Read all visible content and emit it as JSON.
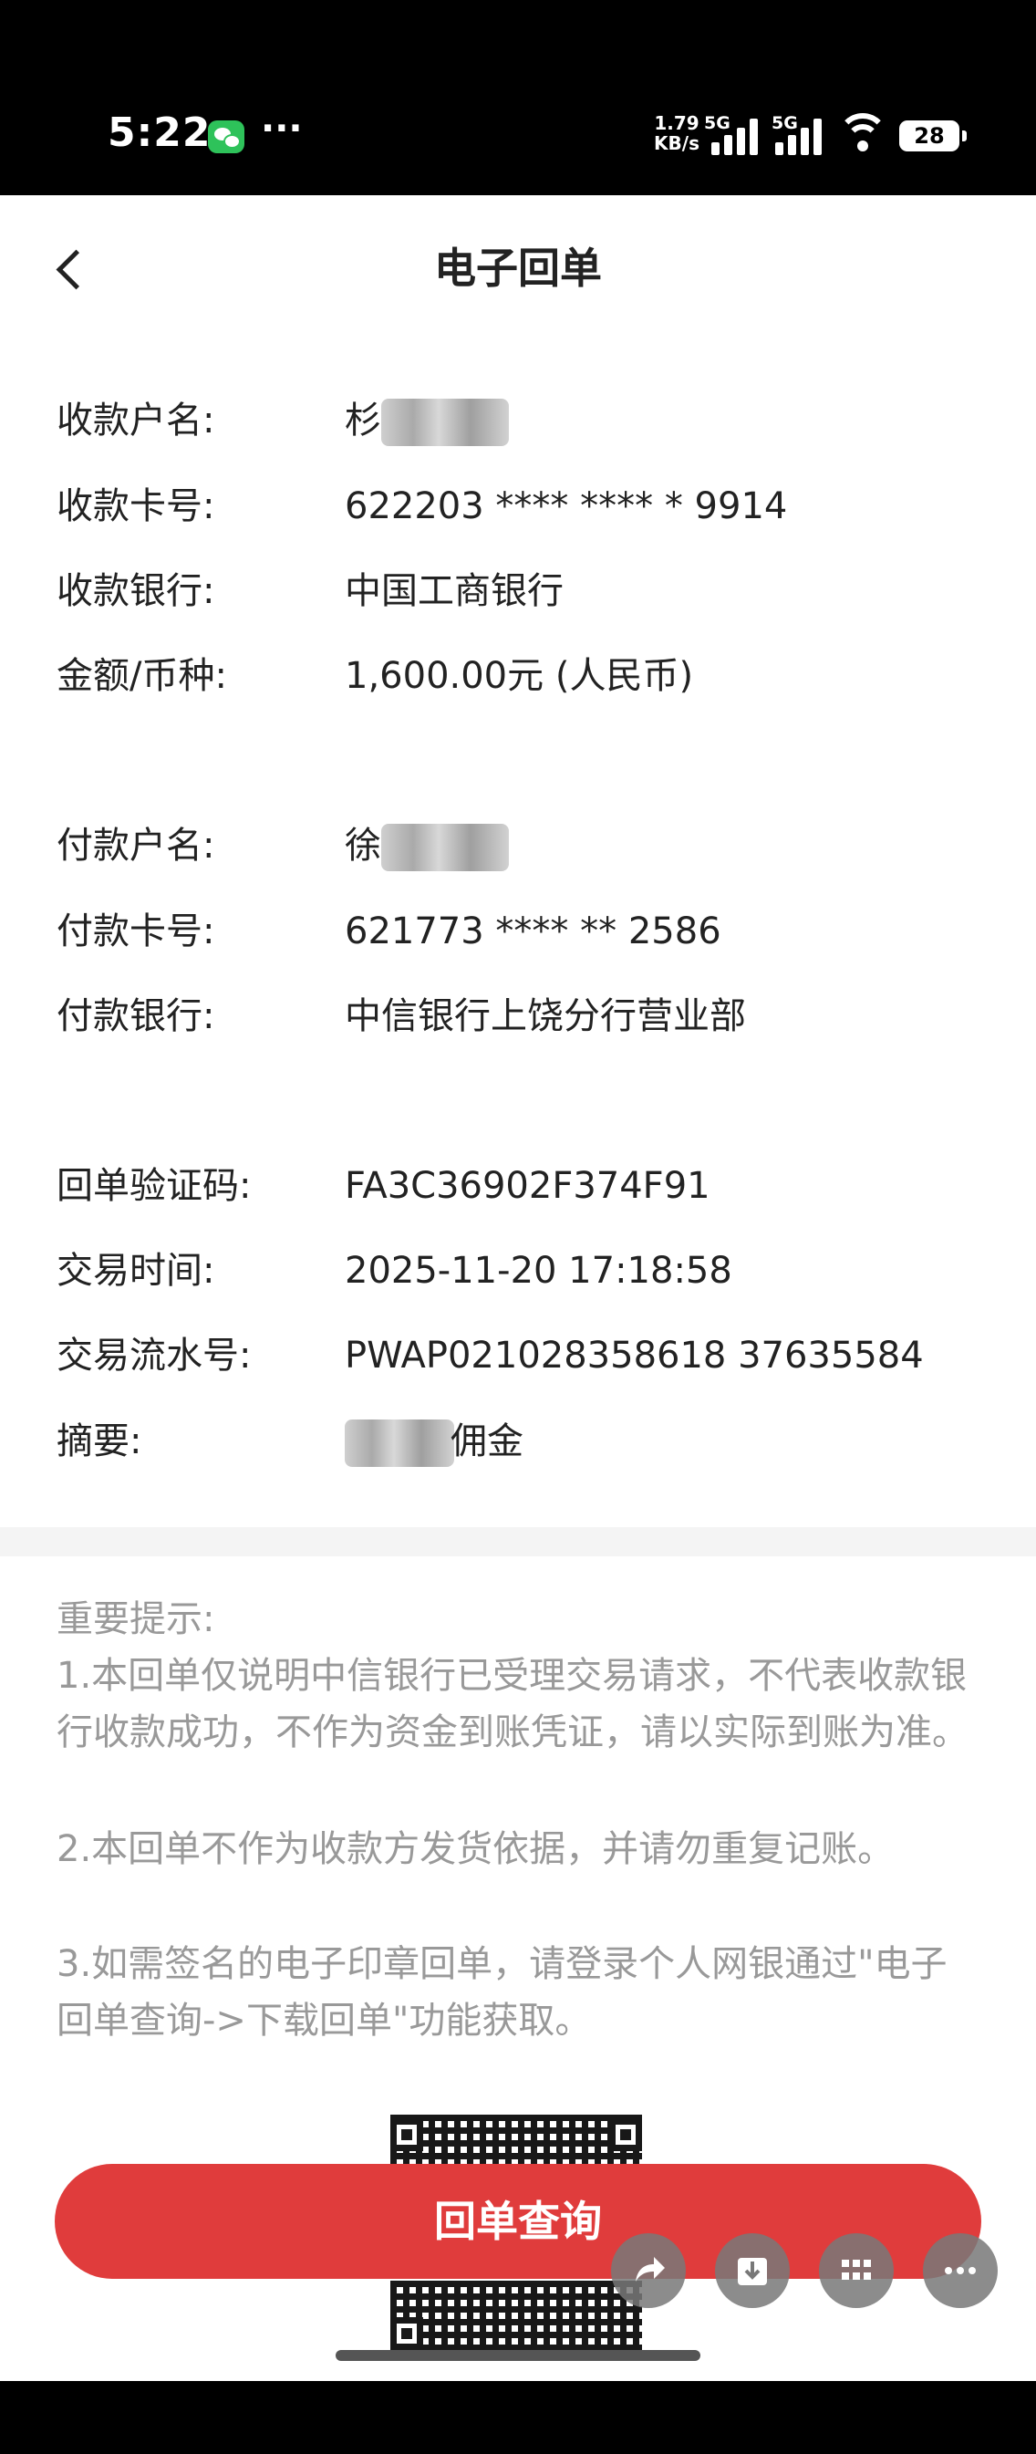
{
  "status_bar": {
    "time": "5:22",
    "more": "···",
    "net_speed": "1.79",
    "net_unit": "KB/s",
    "signal1_label": "5G",
    "signal2_label": "5G",
    "battery": "28",
    "wechat_color": "#2ec25a"
  },
  "header": {
    "title": "电子回单"
  },
  "payee": {
    "name_label": "收款户名:",
    "name_visible": "杉",
    "card_label": "收款卡号:",
    "card_value": "622203 **** **** * 9914",
    "bank_label": "收款银行:",
    "bank_value": "中国工商银行",
    "amount_label": "金额/币种:",
    "amount_value": "1,600.00元 (人民币)"
  },
  "payer": {
    "name_label": "付款户名:",
    "name_visible": "徐",
    "card_label": "付款卡号:",
    "card_value": "621773 **** ** 2586",
    "bank_label": "付款银行:",
    "bank_value": "中信银行上饶分行营业部"
  },
  "transaction": {
    "code_label": "回单验证码:",
    "code_value": "FA3C36902F374F91",
    "time_label": "交易时间:",
    "time_value": "2025-11-20 17:18:58",
    "serial_label": "交易流水号:",
    "serial_value": "PWAP021028358618 37635584",
    "memo_label": "摘要:",
    "memo_value": "佣金"
  },
  "tips": {
    "title": "重要提示:",
    "items": [
      "1.本回单仅说明中信银行已受理交易请求，不代表收款银行收款成功，不作为资金到账凭证，请以实际到账为准。",
      "2.本回单不作为收款方发货依据，并请勿重复记账。",
      "3.如需签名的电子印章回单，请登录个人网银通过\"电子回单查询->下载回单\"功能获取。"
    ]
  },
  "actions": {
    "query_button": "回单查询"
  },
  "colors": {
    "accent": "#e03c3c",
    "tip_text": "#999999",
    "primary_text": "#222222"
  },
  "floating_icons": [
    "share-icon",
    "download-icon",
    "grid-icon",
    "more-icon"
  ]
}
